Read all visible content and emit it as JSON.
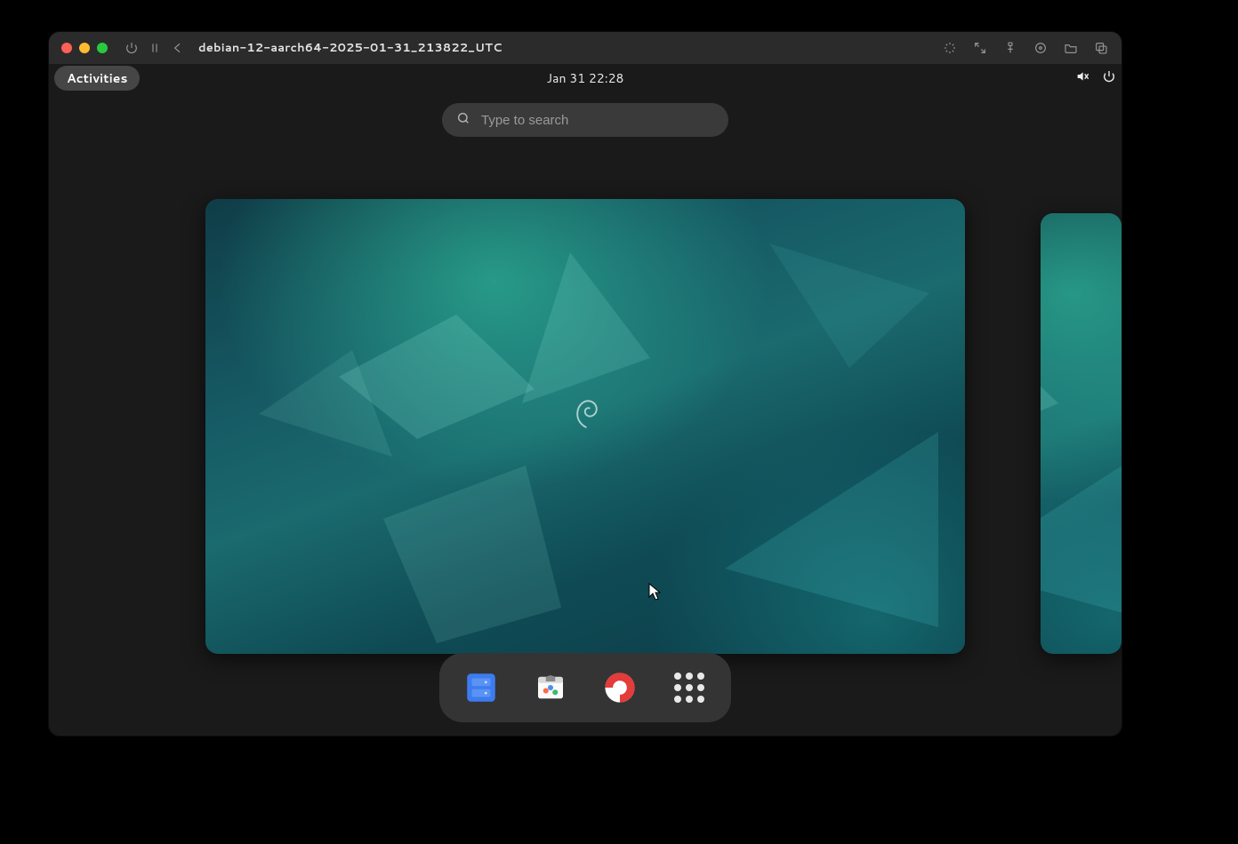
{
  "vm_titlebar": {
    "title": "debian-12-aarch64-2025-01-31_213822_UTC"
  },
  "gnome": {
    "activities_label": "Activities",
    "clock": "Jan 31  22:28",
    "search_placeholder": "Type to search"
  },
  "dock": {
    "items": [
      {
        "name": "files"
      },
      {
        "name": "software"
      },
      {
        "name": "help"
      },
      {
        "name": "app-grid"
      }
    ]
  }
}
